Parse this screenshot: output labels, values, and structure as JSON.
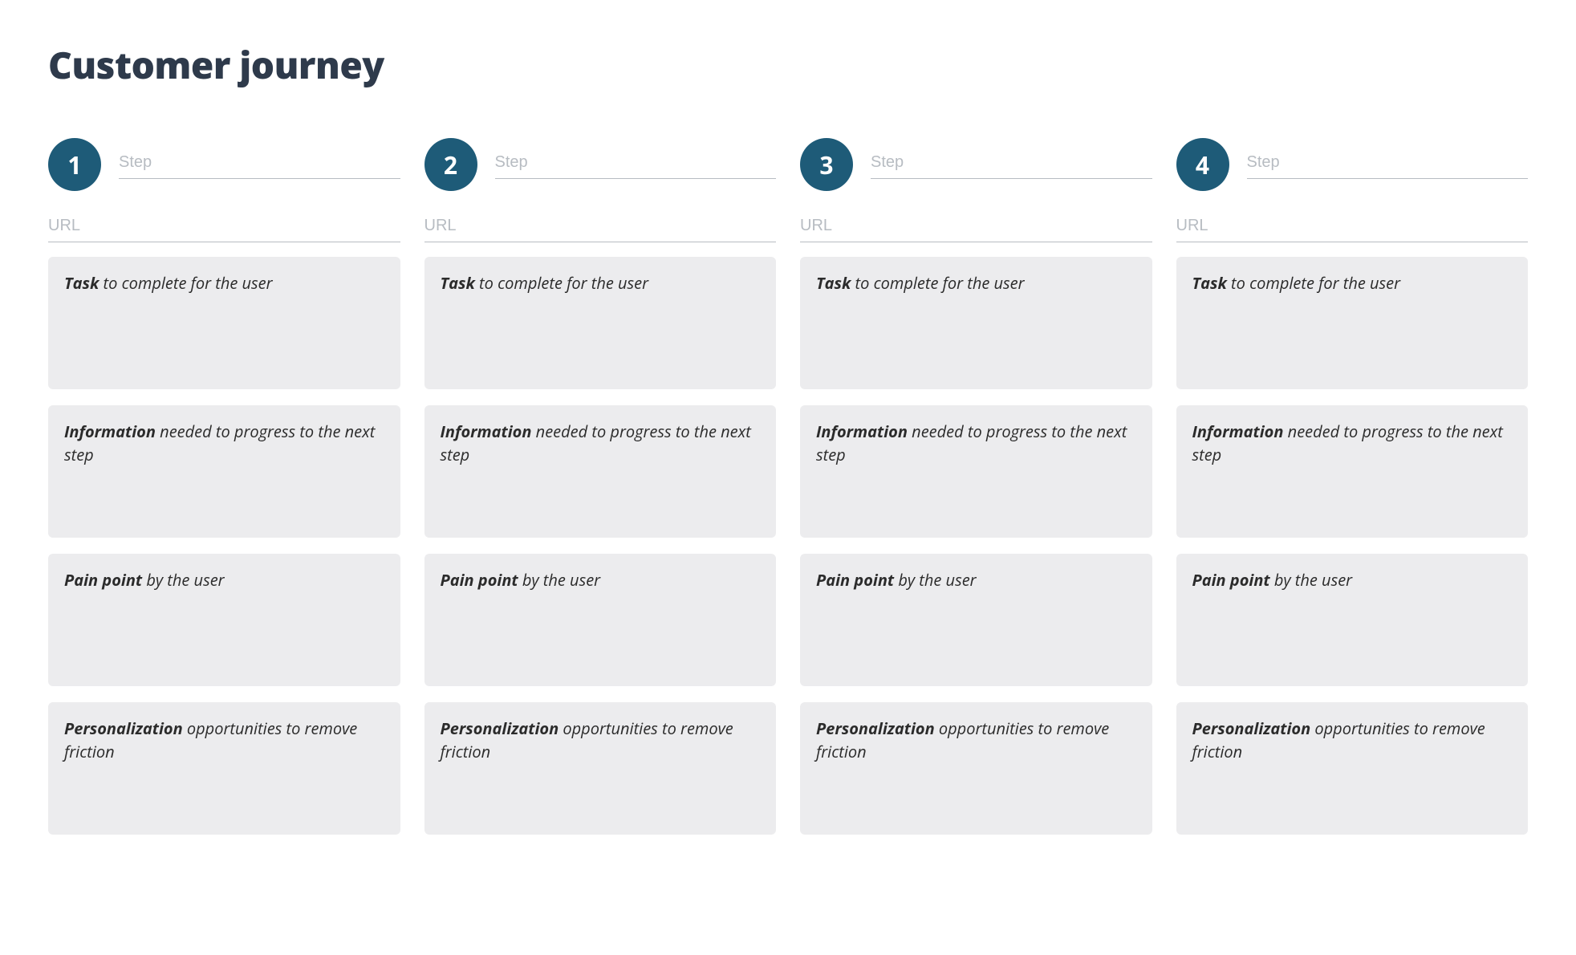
{
  "page": {
    "title": "Customer journey"
  },
  "placeholders": {
    "step": "Step",
    "url": "URL"
  },
  "colors": {
    "accent": "#1e5b78",
    "title": "#2e3a4b",
    "card": "#ececee",
    "muted": "#b7bcc2"
  },
  "cards": {
    "task": {
      "bold": "Task",
      "rest": " to complete for the user"
    },
    "information": {
      "bold": "Information",
      "rest": " needed to progress to the next step"
    },
    "painpoint": {
      "bold": "Pain point",
      "rest": " by the user"
    },
    "personalization": {
      "bold": "Personalization",
      "rest": " opportunities to remove friction"
    }
  },
  "steps": [
    {
      "number": "1",
      "step_value": "",
      "url_value": ""
    },
    {
      "number": "2",
      "step_value": "",
      "url_value": ""
    },
    {
      "number": "3",
      "step_value": "",
      "url_value": ""
    },
    {
      "number": "4",
      "step_value": "",
      "url_value": ""
    }
  ]
}
